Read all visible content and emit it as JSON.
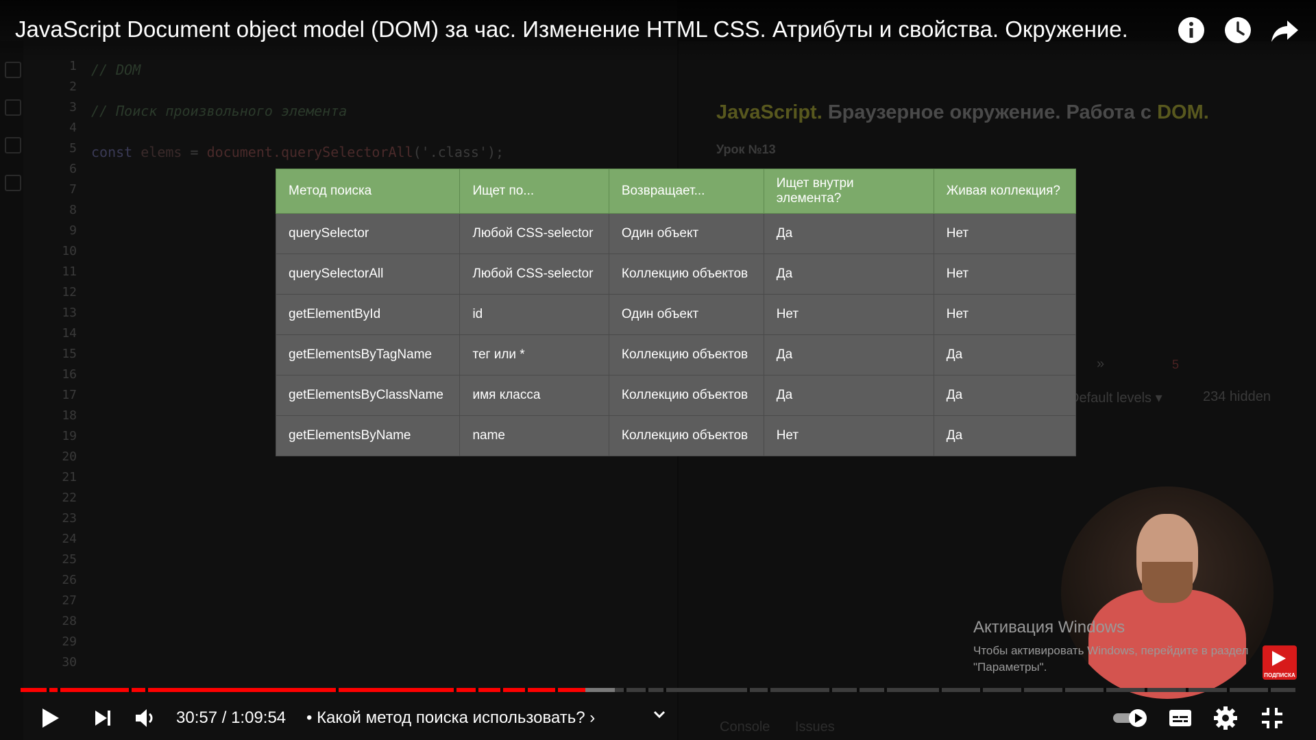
{
  "video": {
    "title": "JavaScript Document object model (DOM) за час. Изменение HTML CSS. Атрибуты и свойства. Окружение.",
    "time_current": "30:57",
    "time_total": "1:09:54",
    "time_separator": " / ",
    "chapter": "• Какой метод поиска использовать? ›",
    "progress_fraction": 0.443,
    "buffered_fraction": 0.466
  },
  "editor": {
    "line_numbers": [
      "1",
      "2",
      "3",
      "4",
      "5",
      "6",
      "7",
      "8",
      "9",
      "10",
      "11",
      "12",
      "13",
      "14",
      "15",
      "16",
      "17",
      "18",
      "19",
      "20",
      "21",
      "22",
      "23",
      "24",
      "25",
      "26",
      "27",
      "28",
      "29",
      "30"
    ],
    "line1": "// DOM",
    "line3": "// Поиск произвольного элемента",
    "line5_kw": "const ",
    "line5_var": "elems",
    "line5_eq": " = ",
    "line5_doc": "document",
    "line5_method": ".querySelectorAll",
    "line5_rest": "('.class');"
  },
  "slide": {
    "title_js": "JavaScript.",
    "title_middle": " Браузерное окружение. Работа с ",
    "title_dom": "DOM.",
    "lesson": "Урок №13"
  },
  "devtools": {
    "errors": "5",
    "levels": "Default levels ▾",
    "hidden": "234 hidden",
    "console_tab": "Console",
    "issues_tab": "Issues"
  },
  "table": {
    "headers": [
      "Метод поиска",
      "Ищет по...",
      "Возвращает...",
      "Ищет внутри элемента?",
      "Живая коллекция?"
    ],
    "rows": [
      [
        "querySelector",
        "Любой CSS-selector",
        "Один объект",
        "Да",
        "Нет"
      ],
      [
        "querySelectorAll",
        "Любой CSS-selector",
        "Коллекцию объектов",
        "Да",
        "Нет"
      ],
      [
        "getElementById",
        "id",
        "Один объект",
        "Нет",
        "Нет"
      ],
      [
        "getElementsByTagName",
        "тег или *",
        "Коллекцию объектов",
        "Да",
        "Да"
      ],
      [
        "getElementsByClassName",
        "имя класса",
        "Коллекцию объектов",
        "Да",
        "Да"
      ],
      [
        "getElementsByName",
        "name",
        "Коллекцию объектов",
        "Нет",
        "Да"
      ]
    ]
  },
  "watermark": {
    "line1": "Активация Windows",
    "line2": "Чтобы активировать Windows, перейдите в раздел",
    "line3": "\"Параметры\"."
  },
  "subscribe_badge": "ПОДПИСКА",
  "icons": {
    "info": "info-icon",
    "watch_later": "clock-icon",
    "share": "share-icon",
    "play": "play-icon",
    "next": "next-icon",
    "volume": "volume-icon",
    "expand": "chevron-down-icon",
    "autoplay": "autoplay-toggle-icon",
    "subtitles": "subtitles-icon",
    "settings": "gear-icon",
    "exit_fullscreen": "exit-fullscreen-icon"
  },
  "colors": {
    "progress": "#ff0000",
    "table_header": "#7caa6a",
    "table_cell": "#5d5d5d"
  }
}
